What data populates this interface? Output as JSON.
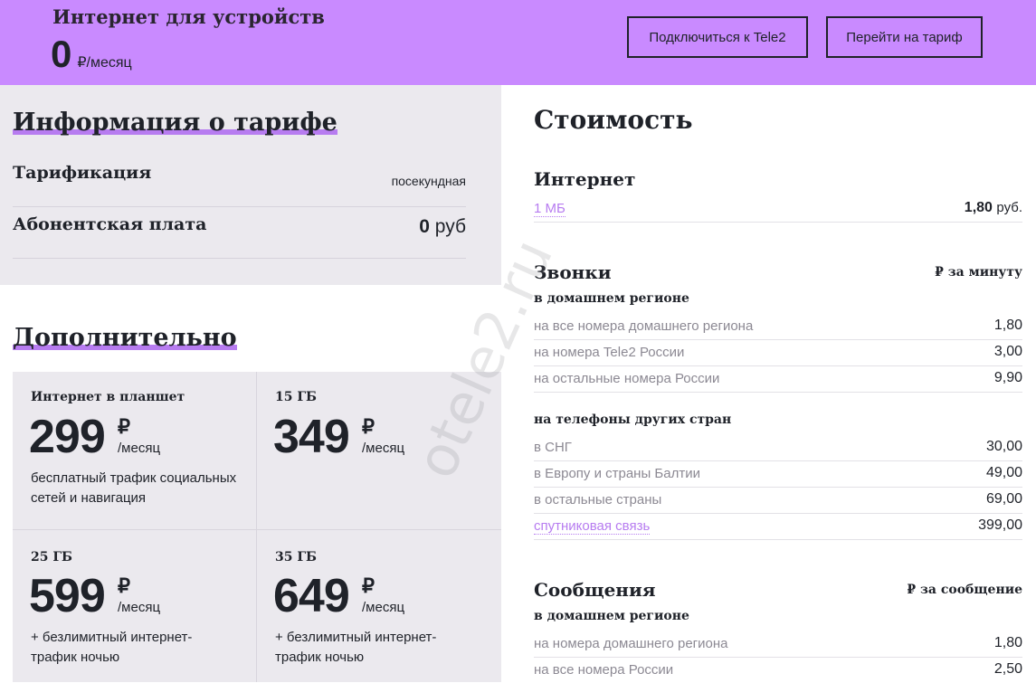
{
  "banner": {
    "title": "Интернет для устройств",
    "price": "0",
    "price_unit": "₽/месяц",
    "connect_label": "Подключиться к Tele2",
    "go_label": "Перейти на тариф"
  },
  "info": {
    "heading": "Информация о тарифе",
    "rows": [
      {
        "label": "Тарификация",
        "value": "посекундная"
      },
      {
        "label": "Абонентская плата",
        "value_num": "0",
        "value_unit": "руб"
      }
    ]
  },
  "extras": {
    "heading": "Дополнительно",
    "cards": [
      {
        "title": "Интернет в планшет",
        "price": "299",
        "currency": "₽",
        "period": "/месяц",
        "desc": "бесплатный трафик социальных сетей и навигация"
      },
      {
        "title": "15 ГБ",
        "price": "349",
        "currency": "₽",
        "period": "/месяц",
        "desc": ""
      },
      {
        "title": "25 ГБ",
        "price": "599",
        "currency": "₽",
        "period": "/месяц",
        "desc": "+ безлимитный интернет-трафик ночью"
      },
      {
        "title": "35 ГБ",
        "price": "649",
        "currency": "₽",
        "period": "/месяц",
        "desc": "+ безлимитный интернет-трафик ночью"
      }
    ]
  },
  "cost": {
    "heading": "Стоимость",
    "internet": {
      "heading": "Интернет",
      "row": {
        "label": "1 МБ",
        "value": "1,80",
        "unit": "руб."
      }
    },
    "calls": {
      "heading": "Звонки",
      "unit": "₽ за минуту",
      "home_heading": "в домашнем регионе",
      "home_rows": [
        {
          "label": "на все номера домашнего региона",
          "value": "1,80"
        },
        {
          "label": "на номера Tele2 России",
          "value": "3,00"
        },
        {
          "label": "на остальные номера России",
          "value": "9,90"
        }
      ],
      "intl_heading": "на телефоны других стран",
      "intl_rows": [
        {
          "label": "в СНГ",
          "value": "30,00"
        },
        {
          "label": "в Европу и страны Балтии",
          "value": "49,00"
        },
        {
          "label": "в остальные страны",
          "value": "69,00"
        },
        {
          "label": "спутниковая связь",
          "value": "399,00"
        }
      ]
    },
    "sms": {
      "heading": "Сообщения",
      "unit": "₽ за сообщение",
      "home_heading": "в домашнем регионе",
      "rows": [
        {
          "label": "на номера домашнего региона",
          "value": "1,80"
        },
        {
          "label": "на все номера России",
          "value": "2,50"
        }
      ]
    }
  },
  "watermark": "otele2.ru",
  "colors": {
    "accent": "#c98aff",
    "highlight": "#b77cf0",
    "panel": "#ebe9ee"
  }
}
